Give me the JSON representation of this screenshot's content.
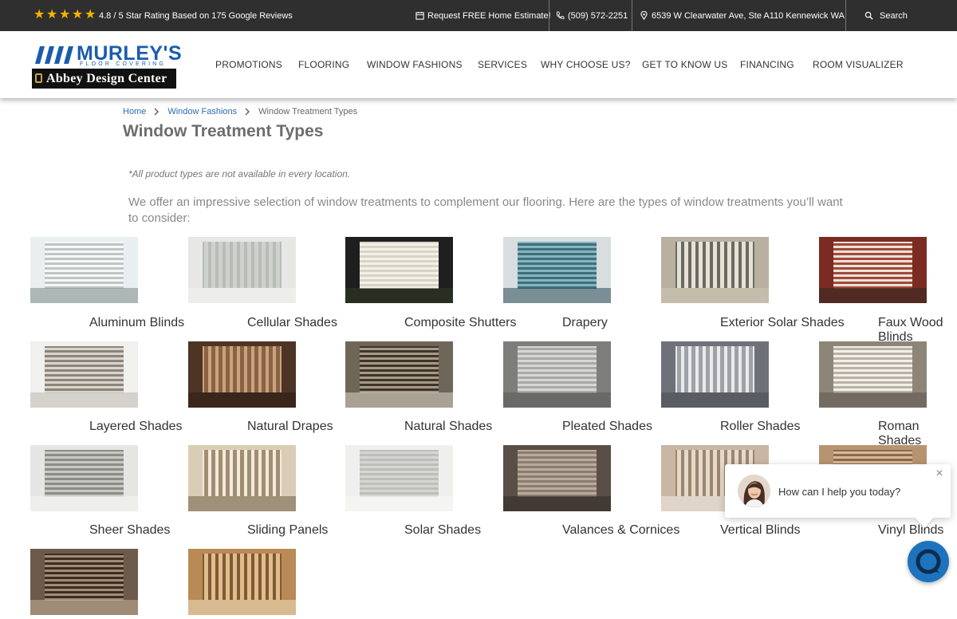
{
  "topbar": {
    "stars": [
      "★",
      "★",
      "★",
      "★",
      "★"
    ],
    "rating_text": "4.8 / 5 Star Rating Based on 175 Google Reviews",
    "estimate": "Request FREE Home Estimate!",
    "phone": "(509) 572-2251",
    "address": "6539 W Clearwater Ave, Ste A110 Kennewick WA",
    "search": "Search",
    "star_color": "#f5b301"
  },
  "logo": {
    "brand": "MURLEY'S",
    "sub": "FLOOR COVERING",
    "abbey": "Abbey Design Center"
  },
  "nav": [
    "PROMOTIONS",
    "FLOORING",
    "WINDOW FASHIONS",
    "SERVICES",
    "WHY CHOOSE US?",
    "GET TO KNOW US",
    "FINANCING",
    "ROOM VISUALIZER"
  ],
  "breadcrumb": {
    "home": "Home",
    "parent": "Window Fashions",
    "current": "Window Treatment Types"
  },
  "title": "Window Treatment Types",
  "note": "*All product types are not available in every location.",
  "intro": "We offer an impressive selection of window treatments to complement our flooring. Here are the types of window treatments you’ll want to consider:",
  "products": [
    "Aluminum Blinds",
    "Cellular Shades",
    "Composite Shutters",
    "Drapery",
    "Exterior Solar Shades",
    "Faux Wood Blinds",
    "Layered Shades",
    "Natural Drapes",
    "Natural Shades",
    "Pleated Shades",
    "Roller Shades",
    "Roman Shades",
    "Sheer Shades",
    "Sliding Panels",
    "Solar Shades",
    "Valances & Cornices",
    "Vertical Blinds",
    "Vinyl Blinds",
    "",
    ""
  ],
  "chat": {
    "message": "How can I help you today?",
    "close": "×"
  },
  "colors": {
    "link": "#2a6cb6",
    "brand": "#1b5cae",
    "topbar": "#2f2f2f",
    "chat": "#1e73be"
  }
}
